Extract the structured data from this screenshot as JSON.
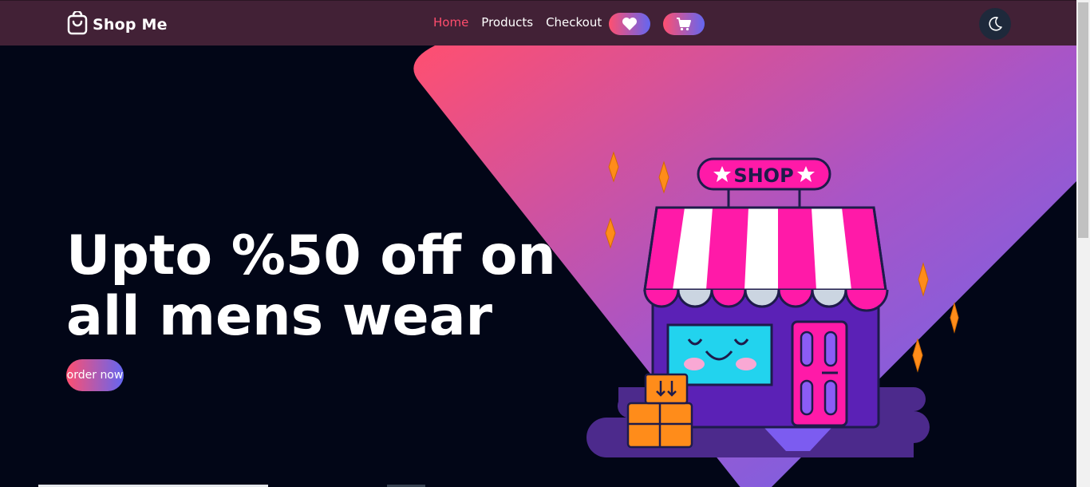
{
  "brand": {
    "name": "Shop Me",
    "icon": "shopping-bag-icon"
  },
  "nav": {
    "links": [
      {
        "label": "Home",
        "active": true
      },
      {
        "label": "Products",
        "active": false
      },
      {
        "label": "Checkout",
        "active": false
      }
    ],
    "wishlist_icon": "heart-icon",
    "cart_icon": "cart-icon",
    "theme_icon": "moon-icon"
  },
  "hero": {
    "headline_line1": "Upto %50 off on",
    "headline_line2": "all mens wear",
    "cta_label": "order now",
    "illustration_sign": "SHOP"
  },
  "colors": {
    "navbar": "#422136",
    "background": "#020617",
    "accent_pink": "#ff4f70",
    "accent_indigo": "#6366f1",
    "active_link": "#ff4d6d"
  }
}
